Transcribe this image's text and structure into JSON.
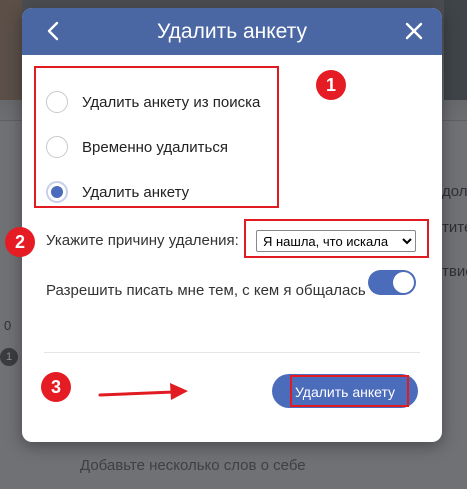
{
  "background": {
    "side_text_top": "доле",
    "side_text_mid": "тите",
    "side_text_low": "твие",
    "side_number": "0",
    "side_badge": "1",
    "bottom_text": "Добавьте несколько слов о себе"
  },
  "modal": {
    "title": "Удалить анкету",
    "options": [
      {
        "label": "Удалить анкету из поиска",
        "selected": false
      },
      {
        "label": "Временно удалиться",
        "selected": false
      },
      {
        "label": "Удалить анкету",
        "selected": true
      }
    ],
    "reason_label": "Укажите причину удаления:",
    "reason_selected": "Я нашла, что искала",
    "allow_label": "Разрешить писать мне тем, с кем я общалась",
    "allow_enabled": true,
    "submit_label": "Удалить анкету"
  },
  "annotations": {
    "badge_1": "1",
    "badge_2": "2",
    "badge_3": "3",
    "color": "#e21b22"
  },
  "colors": {
    "accent": "#4a67a4",
    "button": "#4b6bbb"
  },
  "icons": {
    "back": "chevron-left-icon",
    "close": "close-icon",
    "arrow": "arrow-right-icon"
  }
}
